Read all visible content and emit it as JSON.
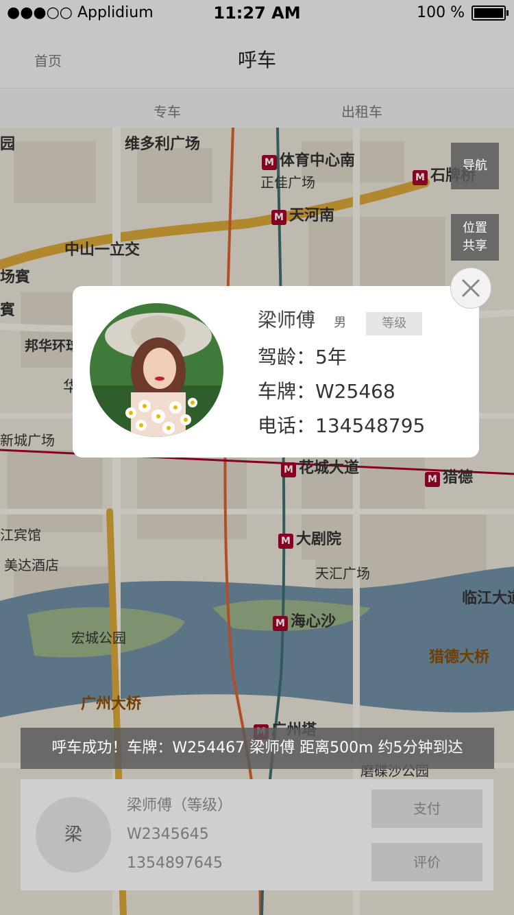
{
  "status_bar": {
    "carrier": "●●●○○ Applidium",
    "time": "11:27 AM",
    "battery": "100 %"
  },
  "nav": {
    "back_label": "首页",
    "title": "呼车"
  },
  "tabs": [
    {
      "label": "专车"
    },
    {
      "label": "出租车"
    }
  ],
  "map": {
    "labels": [
      "维多利广场",
      "体育中心南",
      "正佳广场",
      "天河南",
      "石牌桥",
      "中山一立交",
      "邦华环球",
      "新城广场",
      "花城大道",
      "猎德",
      "大剧院",
      "天汇广场",
      "美达酒店",
      "江宾馆",
      "临江大道",
      "海心沙",
      "宏城公园",
      "猎德大桥",
      "广州大桥",
      "广州塔",
      "磨碟沙公园",
      "园",
      "场賓",
      "賓",
      "华"
    ]
  },
  "side_buttons": {
    "navigation": "导航",
    "share_location": "位置\n共享"
  },
  "driver_popup": {
    "name": "梁师傅",
    "gender": "男",
    "level_label": "等级",
    "driving_years": "驾龄：5年",
    "plate": "车牌：W25468",
    "phone": "电话：134548795"
  },
  "banner": {
    "text": "呼车成功！车牌：W254467 梁师傅  距离500m 约5分钟到达"
  },
  "bottom_card": {
    "avatar_text": "梁",
    "name_level": "梁师傅（等级）",
    "plate": "W2345645",
    "phone": "1354897645",
    "pay_label": "支付",
    "rate_label": "评价"
  }
}
